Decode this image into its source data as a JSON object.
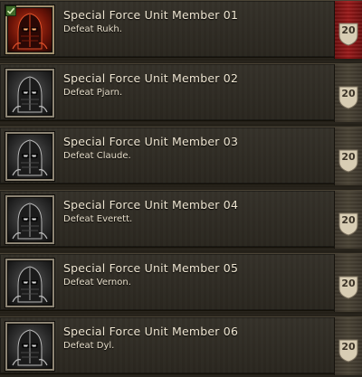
{
  "achievements": [
    {
      "title": "Special Force Unit Member 01",
      "description": "Defeat  Rukh.",
      "points": "20",
      "completed": true
    },
    {
      "title": "Special Force Unit Member 02",
      "description": "Defeat  Pjarn.",
      "points": "20",
      "completed": false
    },
    {
      "title": "Special Force Unit Member 03",
      "description": "Defeat  Claude.",
      "points": "20",
      "completed": false
    },
    {
      "title": "Special Force Unit Member 04",
      "description": "Defeat  Everett.",
      "points": "20",
      "completed": false
    },
    {
      "title": "Special Force Unit Member 05",
      "description": "Defeat  Vernon.",
      "points": "20",
      "completed": false
    },
    {
      "title": "Special Force Unit Member 06",
      "description": "Defeat  Dyl.",
      "points": "20",
      "completed": false
    }
  ],
  "icons": {
    "portrait": "armored-knight-helmet-icon",
    "completed_marker": "checkmark-icon",
    "points_badge": "shield-badge-icon"
  },
  "colors": {
    "completed_ribbon": "#9a1a1a",
    "incomplete_ribbon": "#4a4335",
    "completed_portrait": "#c23a18",
    "incomplete_portrait": "#5a5a5a",
    "title_text": "#efe6d2"
  }
}
